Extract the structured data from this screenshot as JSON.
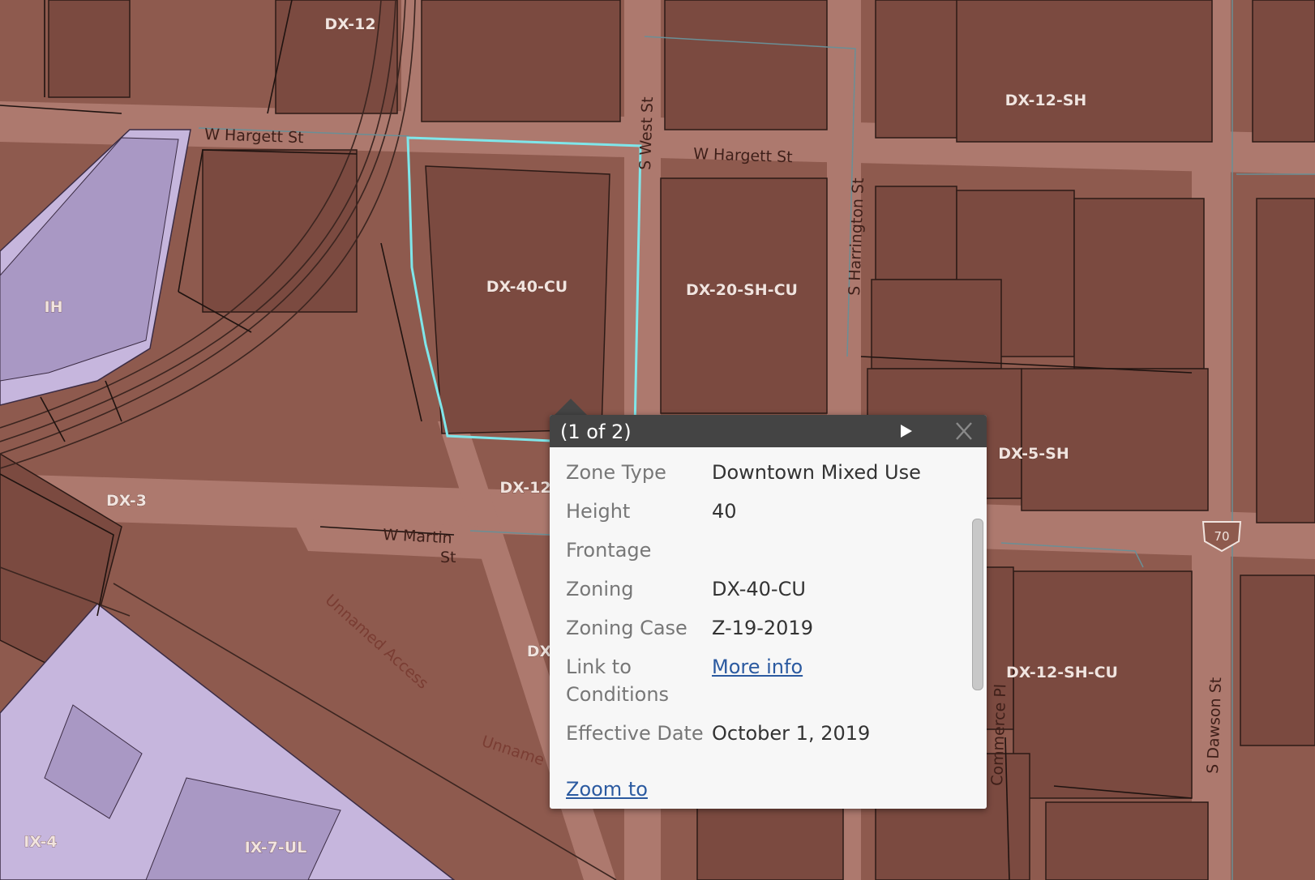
{
  "map": {
    "zone_labels": [
      {
        "id": "dx12-top",
        "text": "DX-12"
      },
      {
        "id": "dx12sh",
        "text": "DX-12-SH"
      },
      {
        "id": "ih",
        "text": "IH"
      },
      {
        "id": "dx40cu",
        "text": "DX-40-CU"
      },
      {
        "id": "dx20shcu",
        "text": "DX-20-SH-CU"
      },
      {
        "id": "dx5sh",
        "text": "DX-5-SH"
      },
      {
        "id": "dx3",
        "text": "DX-3"
      },
      {
        "id": "dx12-mid",
        "text": "DX-12"
      },
      {
        "id": "dx-partial",
        "text": "DX"
      },
      {
        "id": "dx12shcu",
        "text": "DX-12-SH-CU"
      },
      {
        "id": "ix4",
        "text": "IX-4"
      },
      {
        "id": "ix7ul",
        "text": "IX-7-UL"
      }
    ],
    "street_labels": {
      "hargett_west": "W Hargett St",
      "hargett_east": "W Hargett St",
      "west_st": "S West St",
      "harrington": "S Harrington St",
      "martin_1": "W Martin",
      "martin_2": "St",
      "unnamed_access": "Unnamed Access",
      "unnamed_2": "Unname",
      "commerce": "Commerce Pl",
      "dawson": "S Dawson St"
    },
    "route_shield": "70",
    "colors": {
      "dx_zone": "#8e5a4e",
      "industrial_zone": "#c6b6dd",
      "selection_outline": "#7fe6ea"
    }
  },
  "popup": {
    "title": "(1 of 2)",
    "next_icon": "play-triangle-icon",
    "close_icon": "close-icon",
    "attributes": [
      {
        "key": "Zone Type",
        "value": "Downtown Mixed Use"
      },
      {
        "key": "Height",
        "value": "40"
      },
      {
        "key": "Frontage",
        "value": ""
      },
      {
        "key": "Zoning",
        "value": "DX-40-CU"
      },
      {
        "key": "Zoning Case",
        "value": "Z-19-2019"
      },
      {
        "key": "Link to Conditions",
        "value": "More info",
        "is_link": true
      },
      {
        "key": "Effective Date",
        "value": "October 1, 2019"
      }
    ],
    "zoom_link": "Zoom to"
  }
}
